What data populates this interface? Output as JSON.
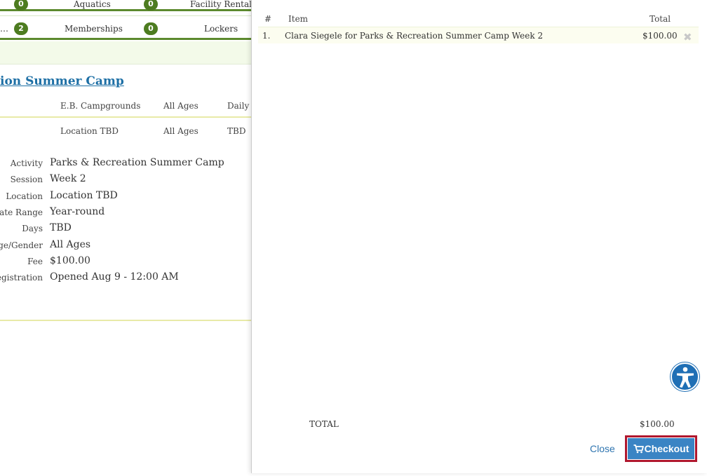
{
  "background": {
    "tabs_row1": [
      {
        "count": "0",
        "label": "Aquatics"
      },
      {
        "count": "0",
        "label": "Facility Rentals"
      }
    ],
    "tabs_row2": [
      {
        "label": "…",
        "count": "2"
      },
      {
        "label": "Memberships",
        "count": "0"
      },
      {
        "label": "Lockers"
      }
    ],
    "activity_title": "ion Summer Camp",
    "sessions": [
      {
        "location": "E.B. Campgrounds",
        "ages": "All Ages",
        "days": "Daily"
      },
      {
        "location": "Location TBD",
        "ages": "All Ages",
        "days": "TBD"
      }
    ],
    "details": [
      {
        "label": "Activity",
        "value": "Parks & Recreation Summer Camp"
      },
      {
        "label": "Session",
        "value": "Week 2"
      },
      {
        "label": "Location",
        "value": "Location TBD"
      },
      {
        "label": "Date Range",
        "value": "Year-round"
      },
      {
        "label": "Days",
        "value": "TBD"
      },
      {
        "label": "Age/Gender",
        "value": "All Ages"
      },
      {
        "label": "Fee",
        "value": "$100.00"
      },
      {
        "label": "Registration",
        "value": "Opened Aug 9 - 12:00 AM"
      }
    ]
  },
  "cart": {
    "columns": {
      "num": "#",
      "item": "Item",
      "total": "Total"
    },
    "items": [
      {
        "num": "1.",
        "item": "Clara Siegele for Parks & Recreation Summer Camp Week 2",
        "total": "$100.00"
      }
    ],
    "total_label": "TOTAL",
    "total_value": "$100.00",
    "close_label": "Close",
    "checkout_label": "Checkout"
  },
  "icons": {
    "remove": "close-icon",
    "checkout": "cart-icon",
    "accessibility": "accessibility-icon"
  },
  "colors": {
    "accent_green": "#4d7c20",
    "link_blue": "#1d6fa5",
    "checkout_blue": "#3a84c4",
    "highlight_red": "#b0172e"
  }
}
